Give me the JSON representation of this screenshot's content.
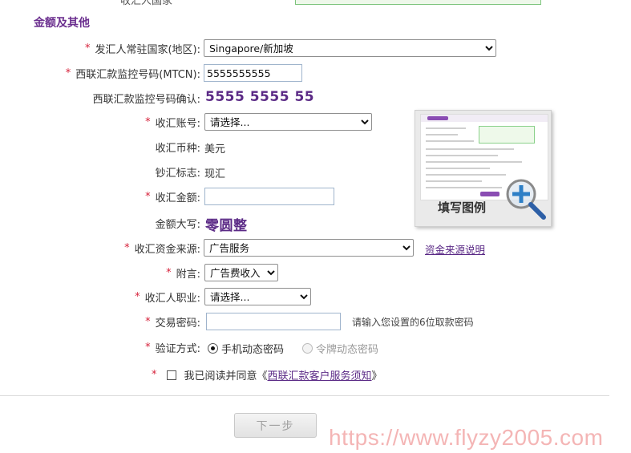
{
  "top_label": "收汇人国家",
  "section_title": "金额及其他",
  "fields": {
    "sender_country": {
      "label": "发汇人常驻国家(地区):",
      "value": "Singapore/新加坡"
    },
    "mtcn": {
      "label": "西联汇款监控号码(MTCN):",
      "value": "5555555555"
    },
    "mtcn_confirm": {
      "label": "西联汇款监控号码确认:",
      "value": "5555 5555 55"
    },
    "account": {
      "label": "收汇账号:",
      "value": "请选择..."
    },
    "currency": {
      "label": "收汇币种:",
      "value": "美元"
    },
    "cash_flag": {
      "label": "钞汇标志:",
      "value": "现汇"
    },
    "amount": {
      "label": "收汇金额:",
      "value": ""
    },
    "amount_words": {
      "label": "金额大写:",
      "value": "零圆整"
    },
    "fund_source": {
      "label": "收汇资金来源:",
      "value": "广告服务",
      "link": "资金来源说明"
    },
    "remark": {
      "label": "附言:",
      "value": "广告费收入"
    },
    "occupation": {
      "label": "收汇人职业:",
      "value": "请选择..."
    },
    "password": {
      "label": "交易密码:",
      "value": "",
      "hint": "请输入您设置的6位取款密码"
    },
    "verify": {
      "label": "验证方式:",
      "option1": "手机动态密码",
      "option2": "令牌动态密码",
      "selected": "手机动态密码"
    }
  },
  "agreement": {
    "prefix": "我已阅读并同意《",
    "link": "西联汇款客户服务须知",
    "suffix": "》",
    "checked": false
  },
  "required_mark": "*",
  "example_caption": "填写图例",
  "next_button": "下一步",
  "watermark": "https://www.flyzy2005.com",
  "colors": {
    "brand_purple": "#5b2a86",
    "required_red": "#d6213a",
    "watermark": "#eb7878"
  }
}
